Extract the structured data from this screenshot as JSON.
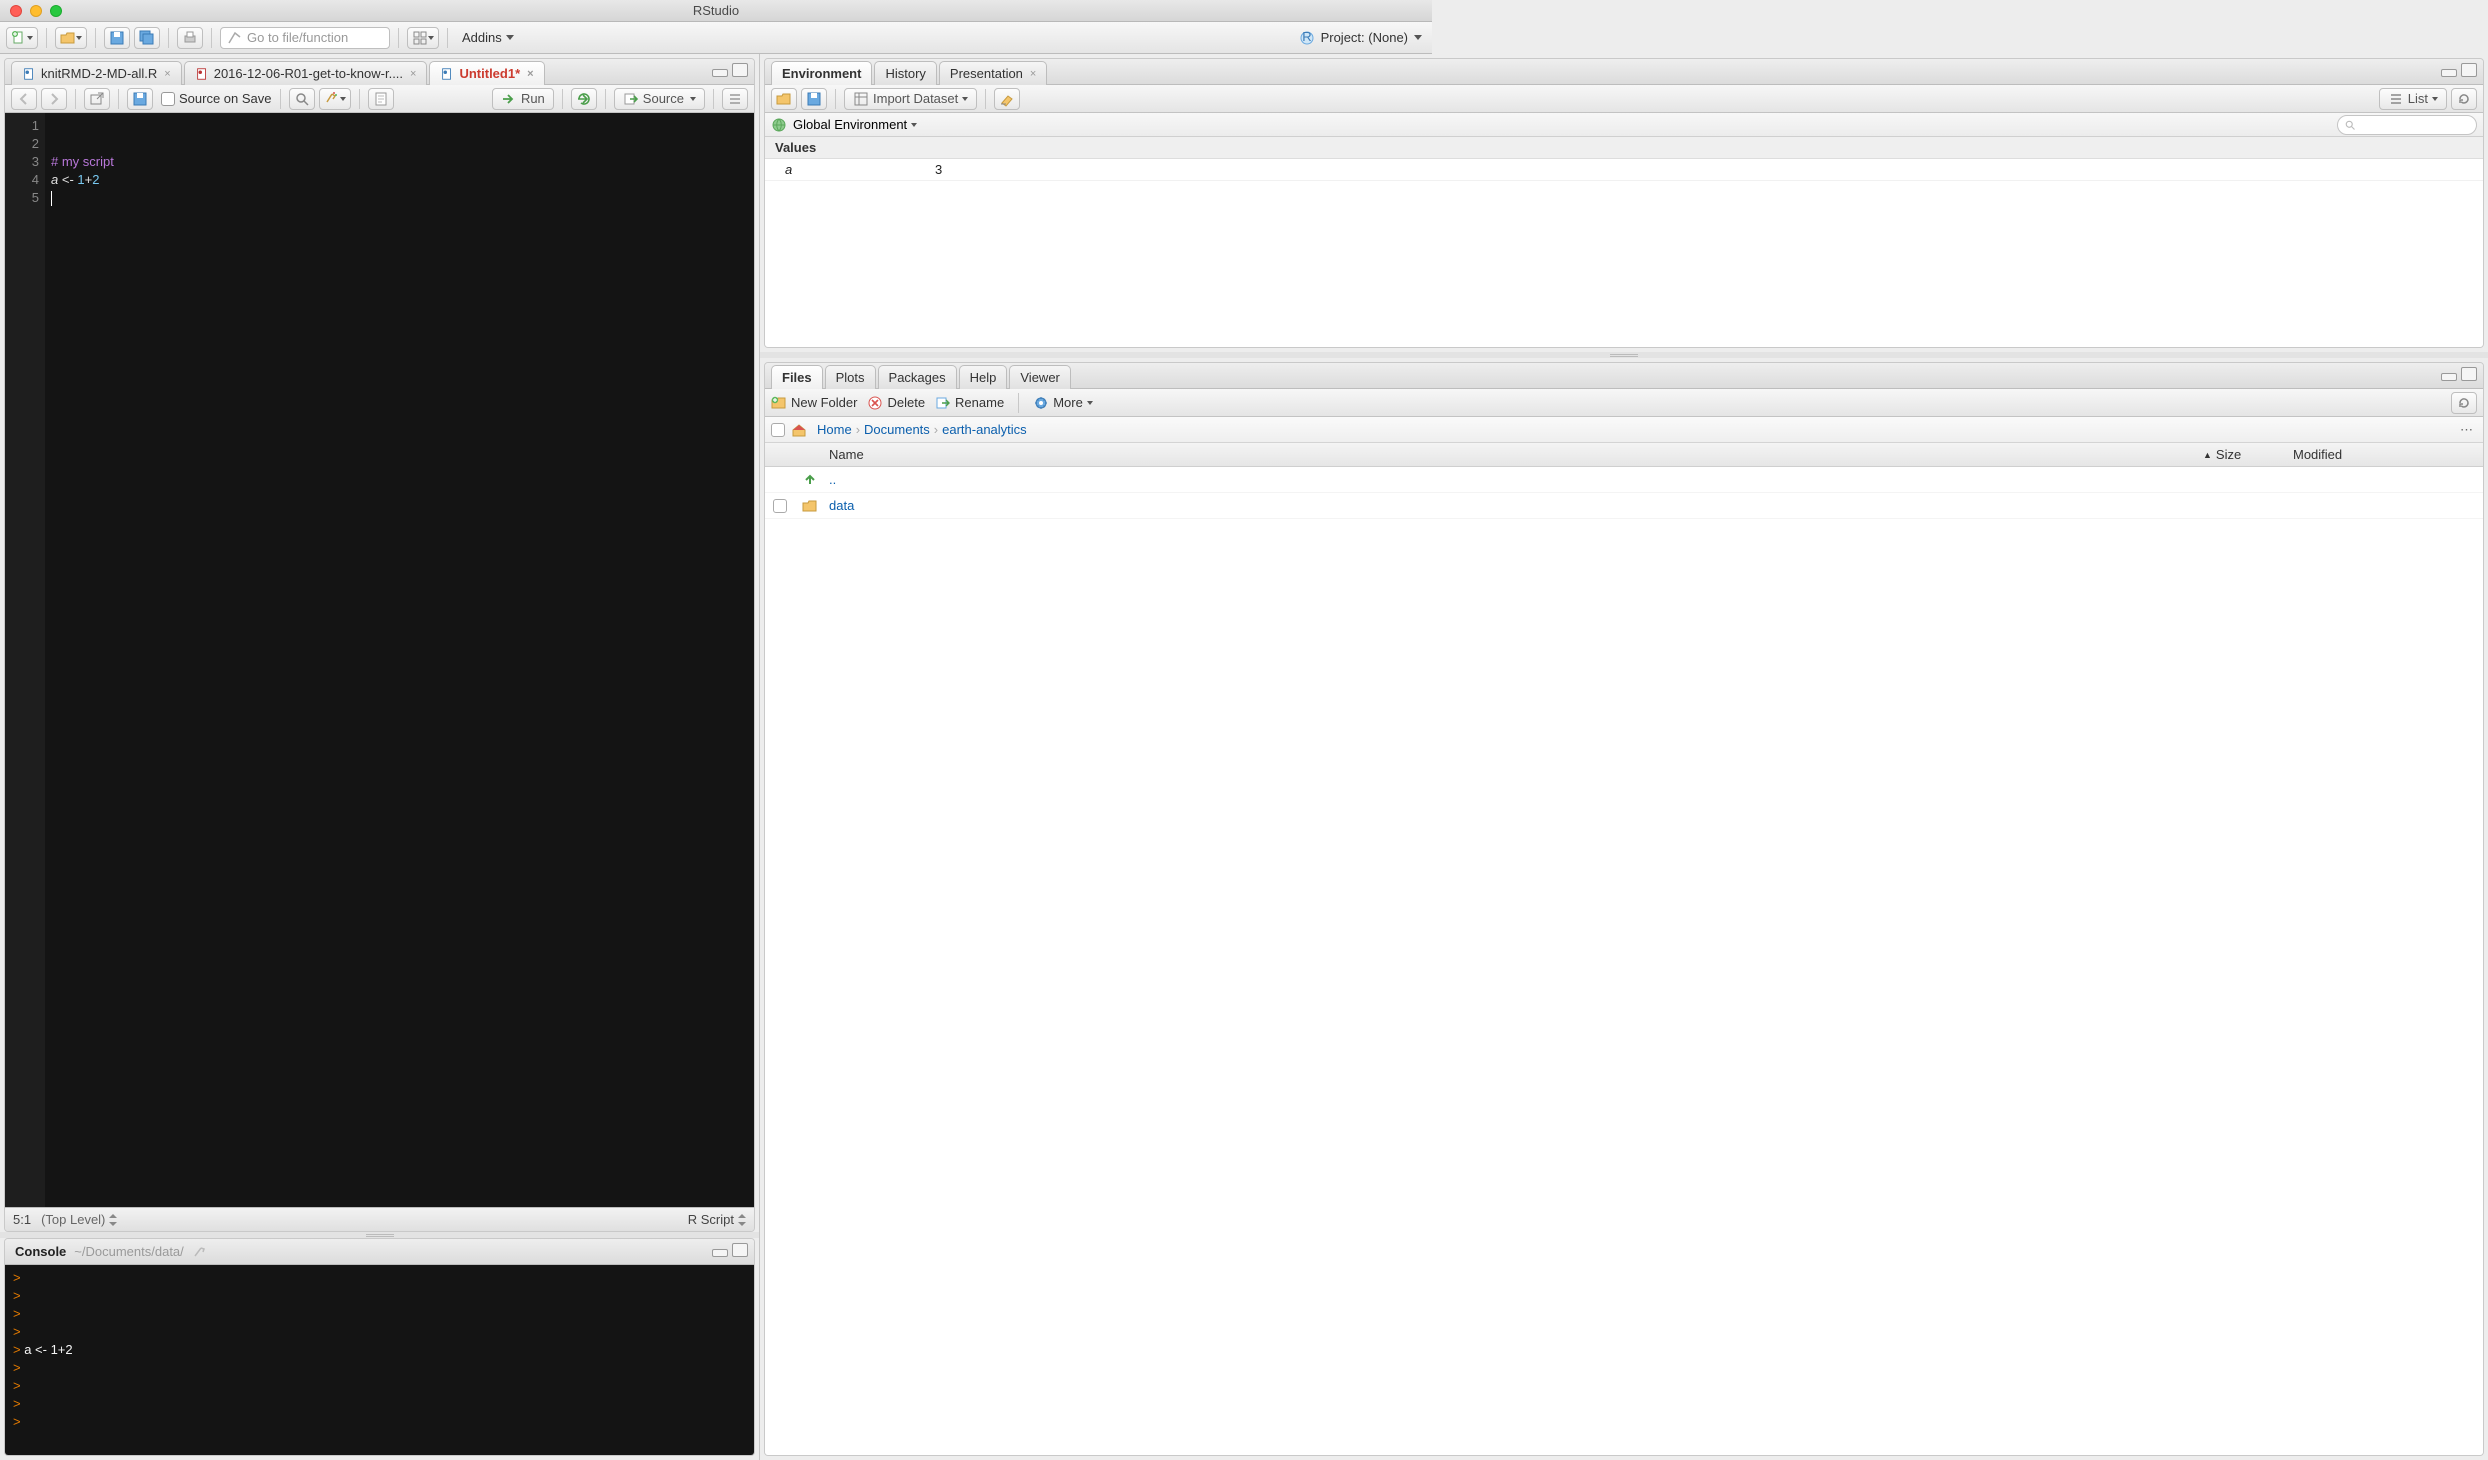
{
  "window": {
    "title": "RStudio"
  },
  "toolbar": {
    "goto_placeholder": "Go to file/function",
    "addins_label": "Addins",
    "project_label": "Project: (None)"
  },
  "source": {
    "tabs": [
      {
        "label": "knitRMD-2-MD-all.R",
        "dirty": false,
        "closable": true,
        "type": "r"
      },
      {
        "label": "2016-12-06-R01-get-to-know-r....",
        "dirty": false,
        "closable": true,
        "type": "rmd"
      },
      {
        "label": "Untitled1*",
        "dirty": true,
        "closable": true,
        "type": "r"
      }
    ],
    "active_tab": 2,
    "toolbar": {
      "source_on_save_label": "Source on Save",
      "run_label": "Run",
      "source_label": "Source"
    },
    "lines": [
      {
        "n": 1,
        "tokens": []
      },
      {
        "n": 2,
        "tokens": []
      },
      {
        "n": 3,
        "tokens": [
          {
            "t": "# my script",
            "c": "tok-comment"
          }
        ]
      },
      {
        "n": 4,
        "tokens": [
          {
            "t": "a",
            "c": "tok-var"
          },
          {
            "t": " <- ",
            "c": "tok-op"
          },
          {
            "t": "1",
            "c": "tok-num"
          },
          {
            "t": "+",
            "c": "tok-op"
          },
          {
            "t": "2",
            "c": "tok-num"
          }
        ]
      },
      {
        "n": 5,
        "tokens": [],
        "cursor": true
      }
    ],
    "status": {
      "pos": "5:1",
      "scope": "(Top Level)",
      "type": "R Script"
    }
  },
  "console": {
    "title": "Console",
    "path": "~/Documents/data/",
    "lines": [
      {
        "prompt": ">",
        "text": ""
      },
      {
        "prompt": ">",
        "text": ""
      },
      {
        "prompt": ">",
        "text": ""
      },
      {
        "prompt": ">",
        "text": ""
      },
      {
        "prompt": ">",
        "text": " a <- 1+2"
      },
      {
        "prompt": ">",
        "text": ""
      },
      {
        "prompt": ">",
        "text": ""
      },
      {
        "prompt": ">",
        "text": ""
      },
      {
        "prompt": ">",
        "text": ""
      }
    ]
  },
  "env": {
    "tabs": [
      "Environment",
      "History",
      "Presentation"
    ],
    "active_tab": 0,
    "toolbar": {
      "import_label": "Import Dataset",
      "view_label": "List"
    },
    "scope_label": "Global Environment",
    "section": "Values",
    "rows": [
      {
        "name": "a",
        "value": "3"
      }
    ]
  },
  "files": {
    "tabs": [
      "Files",
      "Plots",
      "Packages",
      "Help",
      "Viewer"
    ],
    "active_tab": 0,
    "toolbar": {
      "new_folder": "New Folder",
      "delete": "Delete",
      "rename": "Rename",
      "more": "More"
    },
    "breadcrumb": [
      "Home",
      "Documents",
      "earth-analytics"
    ],
    "columns": {
      "name": "Name",
      "size": "Size",
      "modified": "Modified"
    },
    "rows": [
      {
        "type": "up",
        "name": "..",
        "size": "",
        "modified": ""
      },
      {
        "type": "folder",
        "name": "data",
        "size": "",
        "modified": ""
      }
    ]
  }
}
